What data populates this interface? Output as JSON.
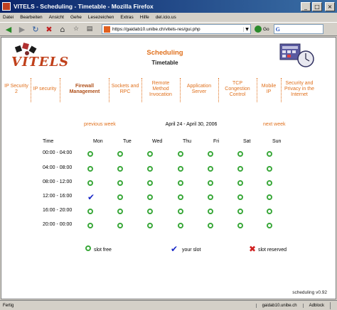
{
  "window": {
    "title": "VITELS - Scheduling - Timetable - Mozilla Firefox"
  },
  "menu": [
    "Datei",
    "Bearbeiten",
    "Ansicht",
    "Gehe",
    "Lesezeichen",
    "Extras",
    "Hilfe",
    "del.icio.us"
  ],
  "toolbar": {
    "url": "https://gaidab10.unibe.ch/vitels-res/gui.php",
    "go_label": "Go",
    "search_prefix": "G"
  },
  "page": {
    "logo_text": "VITELS",
    "title": "Scheduling",
    "subtitle": "Timetable"
  },
  "nav_items": [
    {
      "label": "IP Security 2",
      "active": false
    },
    {
      "label": "IP security",
      "active": false
    },
    {
      "label": "Firewall Management",
      "active": true
    },
    {
      "label": "Sockets and RPC",
      "active": false
    },
    {
      "label": "Remote Method Invocation",
      "active": false
    },
    {
      "label": "Application Server",
      "active": false
    },
    {
      "label": "TCP Congestion Control",
      "active": false
    },
    {
      "label": "Mobile IP",
      "active": false
    },
    {
      "label": "Security and Privacy in the Internet",
      "active": false
    }
  ],
  "week": {
    "prev": "previous week",
    "label": "April 24 - April 30, 2006",
    "next": "next week"
  },
  "grid": {
    "time_header": "Time",
    "days": [
      "Mon",
      "Tue",
      "Wed",
      "Thu",
      "Fri",
      "Sat",
      "Sun"
    ],
    "rows": [
      {
        "time": "00:00 - 04:00",
        "slots": [
          "free",
          "free",
          "free",
          "free",
          "free",
          "free",
          "free"
        ]
      },
      {
        "time": "04:00 - 08:00",
        "slots": [
          "free",
          "free",
          "free",
          "free",
          "free",
          "free",
          "free"
        ]
      },
      {
        "time": "08:00 - 12:00",
        "slots": [
          "free",
          "free",
          "free",
          "free",
          "free",
          "free",
          "free"
        ]
      },
      {
        "time": "12:00 - 16:00",
        "slots": [
          "yours",
          "free",
          "free",
          "free",
          "free",
          "free",
          "free"
        ]
      },
      {
        "time": "16:00 - 20:00",
        "slots": [
          "free",
          "free",
          "free",
          "free",
          "free",
          "free",
          "free"
        ]
      },
      {
        "time": "20:00 - 00:00",
        "slots": [
          "free",
          "free",
          "free",
          "free",
          "free",
          "free",
          "free"
        ]
      }
    ]
  },
  "legend": {
    "free": "slot free",
    "yours": "your slot",
    "reserved": "slot reserved"
  },
  "version": "scheduling v0.92",
  "status": {
    "left": "Fertig",
    "host": "gaidab10.unibe.ch",
    "adblock": "Adblock"
  },
  "colors": {
    "accent": "#e0701c",
    "free": "#3aa83a",
    "yours": "#1a28c8",
    "reserved": "#d02020"
  }
}
